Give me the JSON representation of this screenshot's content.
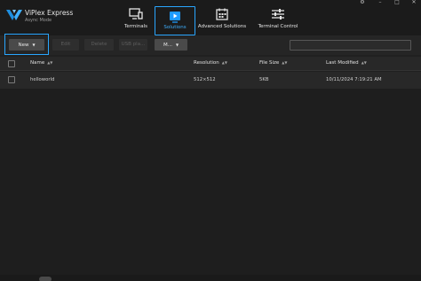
{
  "app": {
    "title": "ViPlex Express",
    "subtitle": "Async Mode"
  },
  "nav": {
    "items": [
      {
        "label": "Terminals",
        "icon": "terminals-icon"
      },
      {
        "label": "Solutions",
        "icon": "solutions-icon",
        "selected": true
      },
      {
        "label": "Advanced Solutions",
        "icon": "calendar-icon"
      },
      {
        "label": "Terminal Control",
        "icon": "sliders-icon"
      }
    ]
  },
  "window": {
    "settings": "⚙",
    "minimize": "–",
    "maximize": "□",
    "close": "✕"
  },
  "toolbar": {
    "new_label": "New",
    "edit_label": "Edit",
    "delete_label": "Delete",
    "usb_label": "USB pla...",
    "more_label": "M...",
    "search_placeholder": ""
  },
  "table": {
    "columns": [
      "Name",
      "Resolution",
      "File Size",
      "Last Modified"
    ],
    "rows": [
      {
        "name": "helloworld",
        "resolution": "512×512",
        "file_size": "5KB",
        "last_modified": "10/11/2024 7:19:21 AM"
      }
    ]
  },
  "colors": {
    "accent": "#29a6ff",
    "background": "#202020"
  }
}
